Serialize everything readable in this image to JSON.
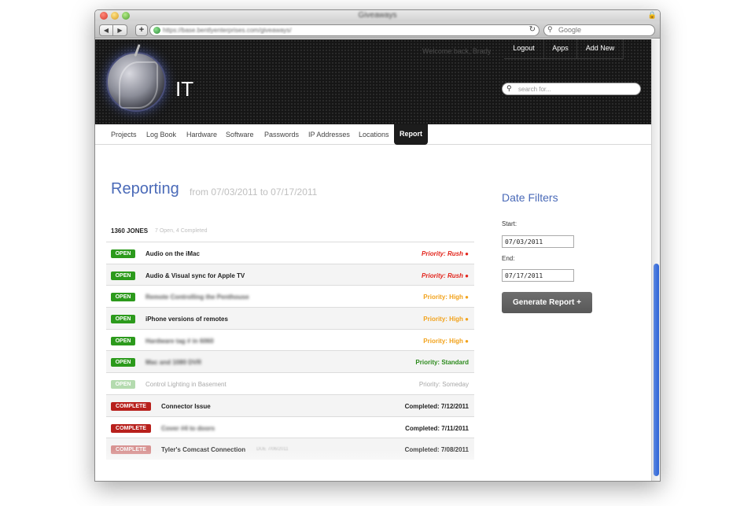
{
  "browser": {
    "window_title": "Giveaways",
    "url": "https://base.bentlyenterprises.com/giveaways/",
    "search_placeholder": "Google",
    "nav_back_icon": "chevron-left-icon",
    "nav_forward_icon": "chevron-right-icon"
  },
  "header": {
    "site_title": "IT",
    "welcome": "Welcome back, Brady",
    "nav": [
      "Logout",
      "Apps",
      "Add New"
    ],
    "search_placeholder": "search for..."
  },
  "tabs": [
    {
      "label": "Projects",
      "active": false
    },
    {
      "label": "Log Book",
      "active": false
    },
    {
      "label": "Hardware",
      "active": false
    },
    {
      "label": "Software",
      "active": false
    },
    {
      "label": "Passwords",
      "active": false
    },
    {
      "label": "IP Addresses",
      "active": false
    },
    {
      "label": "Locations",
      "active": false
    },
    {
      "label": "Report",
      "active": true
    }
  ],
  "report": {
    "title": "Reporting",
    "range": "from 07/03/2011 to 07/17/2011",
    "group_name": "1360 JONES",
    "group_summary": "7 Open, 4 Completed",
    "rows": [
      {
        "badge": "OPEN",
        "title": "Audio on the iMac",
        "status": "Priority: Rush ●"
      },
      {
        "badge": "OPEN",
        "title": "Audio & Visual sync for Apple TV",
        "status": "Priority: Rush ●"
      },
      {
        "badge": "OPEN",
        "title": "Remote Controlling the Penthouse",
        "status": "Priority: High ●"
      },
      {
        "badge": "OPEN",
        "title": "iPhone versions of remotes",
        "status": "Priority: High ●"
      },
      {
        "badge": "OPEN",
        "title": "Hardware tag # in 6060",
        "status": "Priority: High ●"
      },
      {
        "badge": "OPEN",
        "title": "Mac and 1080 DVR",
        "status": "Priority: Standard"
      },
      {
        "badge": "OPEN",
        "title": "Control Lighting in Basement",
        "status": "Priority: Someday"
      },
      {
        "badge": "COMPLETE",
        "title": "Connector Issue",
        "status": "Completed: 7/12/2011"
      },
      {
        "badge": "COMPLETE",
        "title": "Cover #4 to doors",
        "status": "Completed: 7/11/2011"
      },
      {
        "badge": "COMPLETE",
        "title": "Tyler's Comcast Connection",
        "due": "DUE 7/06/2011",
        "status": "Completed: 7/08/2011"
      }
    ]
  },
  "filters": {
    "title": "Date Filters",
    "start_label": "Start:",
    "start_value": "07/03/2011",
    "end_label": "End:",
    "end_value": "07/17/2011",
    "generate_label": "Generate Report +"
  },
  "colors": {
    "accent": "#4a6ab8",
    "open": "#2c9a1c",
    "complete": "#b8201c",
    "rush": "#e2231a",
    "high": "#f2a21b",
    "standard": "#2c8a1c",
    "someday": "#a8a8a8"
  }
}
